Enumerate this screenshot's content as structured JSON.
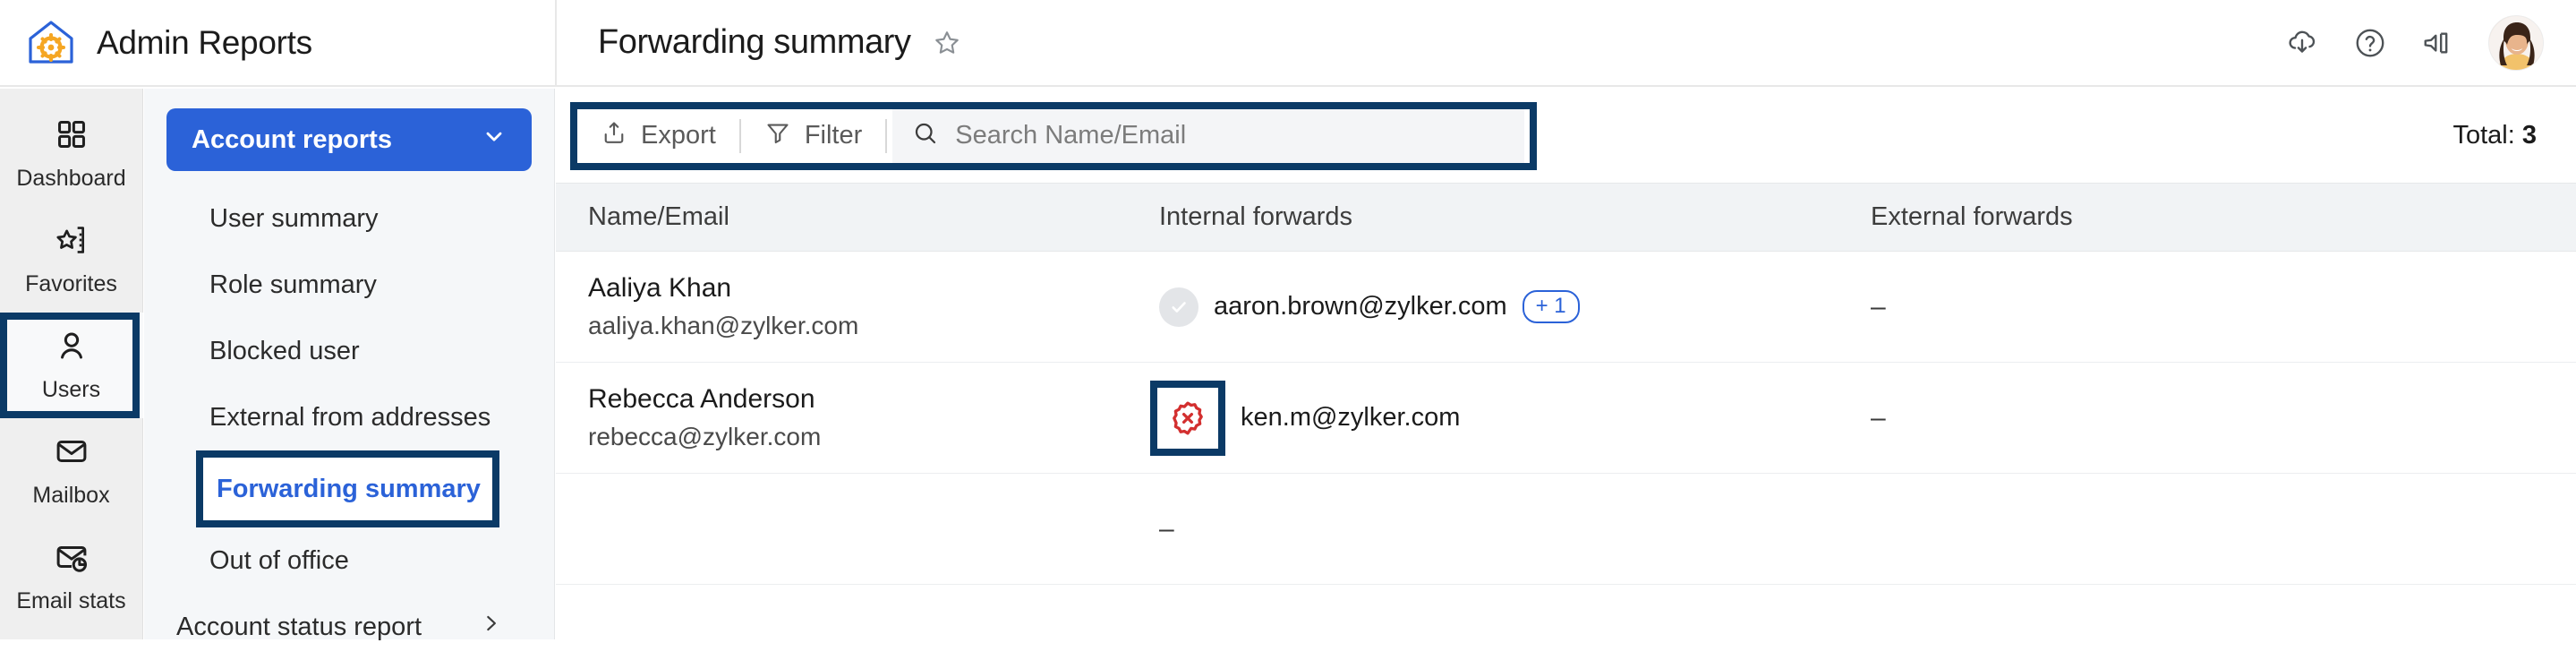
{
  "app": {
    "title": "Admin Reports",
    "logo_icon": "house-gear-icon"
  },
  "header": {
    "page_title": "Forwarding summary",
    "favorite_icon": "star-outline-icon",
    "actions": [
      {
        "name": "cloud-download-icon",
        "label": "Download"
      },
      {
        "name": "help-icon",
        "label": "Help"
      },
      {
        "name": "announcement-icon",
        "label": "Announcements"
      }
    ],
    "avatar": "user-avatar"
  },
  "rail": {
    "items": [
      {
        "label": "Dashboard",
        "icon": "grid-icon",
        "selected": false,
        "highlighted": false
      },
      {
        "label": "Favorites",
        "icon": "star-list-icon",
        "selected": false,
        "highlighted": false
      },
      {
        "label": "Users",
        "icon": "user-icon",
        "selected": true,
        "highlighted": true
      },
      {
        "label": "Mailbox",
        "icon": "envelope-icon",
        "selected": false,
        "highlighted": false
      },
      {
        "label": "Email stats",
        "icon": "mail-chart-icon",
        "selected": false,
        "highlighted": false
      }
    ]
  },
  "subnav": {
    "header": {
      "label": "Account reports",
      "icon": "chevron-down-icon"
    },
    "items": [
      {
        "label": "User summary",
        "active": false,
        "highlighted": false,
        "caret": false
      },
      {
        "label": "Role summary",
        "active": false,
        "highlighted": false,
        "caret": false
      },
      {
        "label": "Blocked user",
        "active": false,
        "highlighted": false,
        "caret": false
      },
      {
        "label": "External from addresses",
        "active": false,
        "highlighted": false,
        "caret": false
      },
      {
        "label": "Forwarding summary",
        "active": true,
        "highlighted": true,
        "caret": false
      },
      {
        "label": "Out of office",
        "active": false,
        "highlighted": false,
        "caret": false
      },
      {
        "label": "Account status report",
        "active": false,
        "highlighted": false,
        "caret": true
      }
    ]
  },
  "toolbar": {
    "export_label": "Export",
    "export_icon": "upload-icon",
    "filter_label": "Filter",
    "filter_icon": "funnel-icon",
    "search_icon": "search-icon",
    "search_placeholder": "Search Name/Email",
    "search_value": "",
    "total_label": "Total:",
    "total_value": "3"
  },
  "table": {
    "columns": [
      "Name/Email",
      "Internal forwards",
      "External forwards"
    ],
    "rows": [
      {
        "name": "Aaliya Khan",
        "email": "aaliya.khan@zylker.com",
        "internal": {
          "status_icon": "check-circle-icon",
          "status": "ok",
          "address": "aaron.brown@zylker.com",
          "more_badge": "+ 1"
        },
        "external": "–",
        "blurred": false
      },
      {
        "name": "Rebecca Anderson",
        "email": "rebecca@zylker.com",
        "internal": {
          "status_icon": "error-badge-icon",
          "status": "error",
          "address": "ken.m@zylker.com",
          "more_badge": ""
        },
        "external": "–",
        "blurred": false
      },
      {
        "name": "",
        "email": "",
        "internal": {
          "status_icon": "",
          "status": "none",
          "address": "–",
          "more_badge": ""
        },
        "external": "",
        "blurred": true
      }
    ]
  },
  "colors": {
    "brand_blue": "#2b62d8",
    "highlight_navy": "#0b3a66",
    "error_red": "#d32f2f",
    "rail_bg": "#efefef",
    "subnav_bg": "#f5f7f9"
  }
}
